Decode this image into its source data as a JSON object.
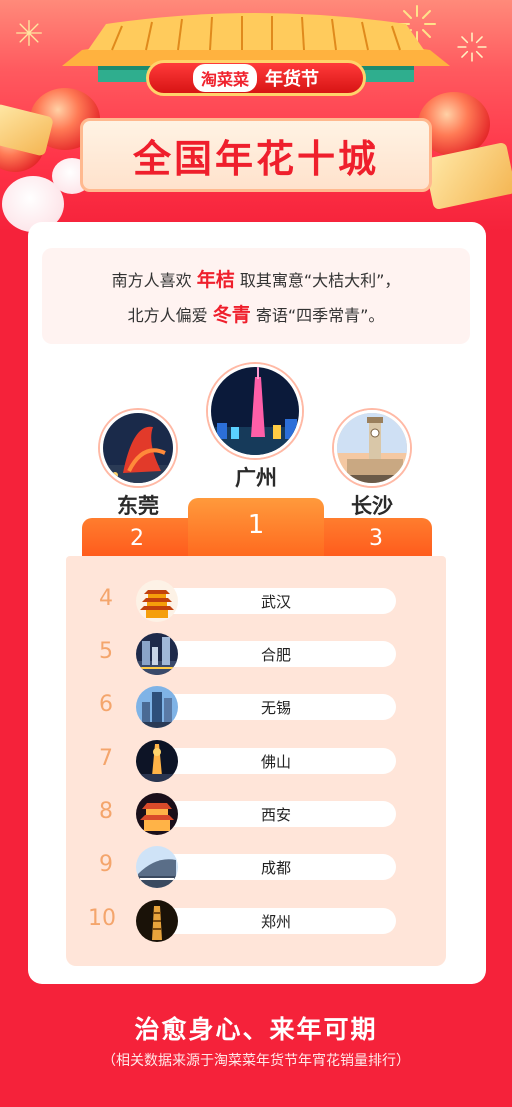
{
  "header": {
    "brand": "淘菜菜",
    "festival": "年货节",
    "title": "全国年花十城"
  },
  "quote": {
    "line1_pre": "南方人喜欢",
    "line1_hl": "年桔",
    "line1_post": "取其寓意“大桔大利”，",
    "line2_pre": "北方人偏爱",
    "line2_hl": "冬青",
    "line2_post": "寄语“四季常青”。"
  },
  "podium": {
    "first": {
      "rank": "1",
      "city": "广州"
    },
    "second": {
      "rank": "2",
      "city": "东莞"
    },
    "third": {
      "rank": "3",
      "city": "长沙"
    }
  },
  "ranking": [
    {
      "rank": "4",
      "city": "武汉"
    },
    {
      "rank": "5",
      "city": "合肥"
    },
    {
      "rank": "6",
      "city": "无锡"
    },
    {
      "rank": "7",
      "city": "佛山"
    },
    {
      "rank": "8",
      "city": "西安"
    },
    {
      "rank": "9",
      "city": "成都"
    },
    {
      "rank": "10",
      "city": "郑州"
    }
  ],
  "footer": {
    "slogan": "治愈身心、来年可期",
    "source": "（相关数据来源于淘菜菜年货节年宵花销量排行）"
  },
  "colors": {
    "primary_red": "#f5223a",
    "podium_orange": "#ff6a1f",
    "rank_number": "#f4a56c"
  }
}
